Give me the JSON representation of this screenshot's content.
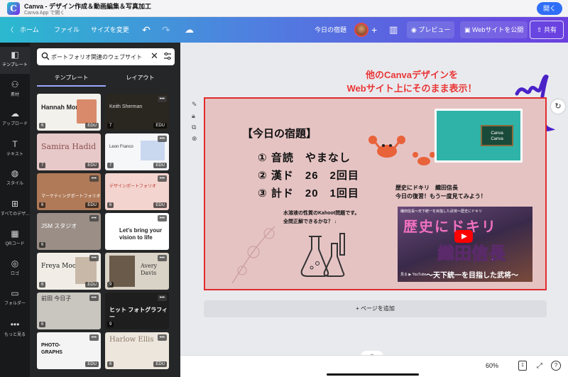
{
  "app": {
    "title": "Canva - デザイン作成＆動画編集＆写真加工",
    "subtitle": "Canva App で開く",
    "open_label": "開く",
    "logo_letter": "C"
  },
  "toolbar": {
    "home": "〈　ホーム",
    "file": "ファイル",
    "resize": "サイズを変更",
    "undo_icon": "↶",
    "redo_icon": "↷",
    "cloud_icon": "☁",
    "doc_title": "今日の宿題",
    "add_icon": "+",
    "chart_icon": "▥",
    "preview": "◉ プレビュー",
    "publish": "▣ Webサイトを公開",
    "share": "⇧ 共有"
  },
  "rail": [
    {
      "icon": "◧",
      "label": "テンプレート"
    },
    {
      "icon": "⚇",
      "label": "素材"
    },
    {
      "icon": "☁",
      "label": "アップロード"
    },
    {
      "icon": "T",
      "label": "テキスト"
    },
    {
      "icon": "◍",
      "label": "スタイル"
    },
    {
      "icon": "⊞",
      "label": "すべてのデザ..."
    },
    {
      "icon": "▦",
      "label": "QRコード"
    },
    {
      "icon": "◎",
      "label": "ロゴ"
    },
    {
      "icon": "▭",
      "label": "フォルダー"
    },
    {
      "icon": "•••",
      "label": "もっと見る"
    }
  ],
  "panel": {
    "search_value": "ポートフォリオ関連のウェブサイト",
    "clear_icon": "✕",
    "tabs": [
      "テンプレート",
      "レイアウト"
    ]
  },
  "templates": [
    {
      "title": "Hannah Morales",
      "count": "6",
      "edu": "EDU",
      "dots": "•••"
    },
    {
      "title": "Keith Sherman",
      "count": "7",
      "edu": "EDU",
      "dots": "•••"
    },
    {
      "title": "Samira Hadid",
      "count": "7",
      "edu": "EDU",
      "dots": "•••"
    },
    {
      "title": "Leon Franco",
      "count": "7",
      "edu": "EDU",
      "dots": "•••"
    },
    {
      "title": "マーケティングポートフォリオ",
      "count": "6",
      "edu": "EDU",
      "dots": "•••"
    },
    {
      "title": "デザインポートフォリオ",
      "count": "6",
      "edu": "EDU",
      "dots": "•••"
    },
    {
      "title": "JSM スタジオ",
      "count": "6",
      "edu": "",
      "dots": "•••"
    },
    {
      "title": "Let's bring your vision to life",
      "count": "",
      "edu": "",
      "dots": "•••"
    },
    {
      "title": "Freya Moore",
      "count": "6",
      "edu": "EDU",
      "dots": "•••"
    },
    {
      "title": "Avery Davis",
      "count": "9",
      "edu": "",
      "dots": "•••"
    },
    {
      "title": "前田 今日子",
      "count": "6",
      "edu": "",
      "dots": "•••"
    },
    {
      "title": "ヒット フォトグラフィー",
      "count": "9",
      "edu": "",
      "dots": "•••"
    },
    {
      "title": "PHOTO-GRAPHS",
      "count": "",
      "edu": "EDU",
      "dots": "•••"
    },
    {
      "title": "Harlow Ellis",
      "count": "6",
      "edu": "EDU",
      "dots": "•••"
    }
  ],
  "annotation": [
    "他のCanvaデザインを",
    "Webサイト上にそのまま表示！"
  ],
  "slide": {
    "title": "【今日の宿題】",
    "lines": [
      "① 音読　やまなし",
      "② 漢ド　26　2回目",
      "③ 計ド　20　1回目"
    ],
    "reminder": [
      "歴史にドキリ　織田信長",
      "今日の復習！もう一度見てみよう！"
    ],
    "kahoot": [
      "水溶液の性質のKahoot問題です。",
      "全問正解できるかな？ ↓"
    ],
    "tv_board": [
      "Canva",
      "Canva"
    ],
    "video": {
      "top_title": "織田信長～天下統一を目指した武将～歴史にドキリ",
      "big_top": "歴史にドキリ",
      "big_name": "織田信長",
      "subtitle": "～天下統一を目指した武将～",
      "yt_label": "見る ▶ YouTube"
    }
  },
  "add_page": "+ ページを追加",
  "bottom": {
    "zoom": "60%",
    "page": "1",
    "expand_icon": "⤢",
    "help": "?",
    "chevron": "︿"
  },
  "colors": {
    "accent_red": "#ea3636",
    "slide_bg": "#e6c3c3",
    "topbar_start": "#2bb9cf",
    "topbar_end": "#6b3fe0"
  }
}
